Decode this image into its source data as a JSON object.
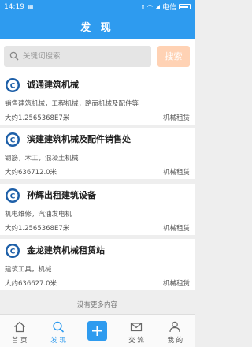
{
  "status_bar": {
    "time": "14:19",
    "carrier": "电信",
    "battery": ""
  },
  "header": {
    "title": "发 现"
  },
  "search": {
    "placeholder": "关键词搜索",
    "button_label": "搜索"
  },
  "listings": [
    {
      "title": "诚通建筑机械",
      "description": "销售建筑机械，工程机械，路面机械及配件等",
      "distance": "大约1.2565368E7米",
      "category": "机械租赁"
    },
    {
      "title": "滨建建筑机械及配件销售处",
      "description": "钢筋，木工，混凝土机械",
      "distance": "大约636712.0米",
      "category": "机械租赁"
    },
    {
      "title": "孙辉出租建筑设备",
      "description": "机电维修，汽油发电机",
      "distance": "大约1.2565368E7米",
      "category": "机械租赁"
    },
    {
      "title": "金龙建筑机械租赁站",
      "description": "建筑工具，机械",
      "distance": "大约636627.0米",
      "category": "机械租赁"
    }
  ],
  "footer_note": "没有更多内容",
  "tabbar": {
    "home": "首 页",
    "discover": "发 现",
    "add": "",
    "exchange": "交 流",
    "mine": "我 的"
  },
  "colors": {
    "primary": "#2e9bef",
    "search_button": "#ffd2b4",
    "background": "#eeeeee"
  }
}
